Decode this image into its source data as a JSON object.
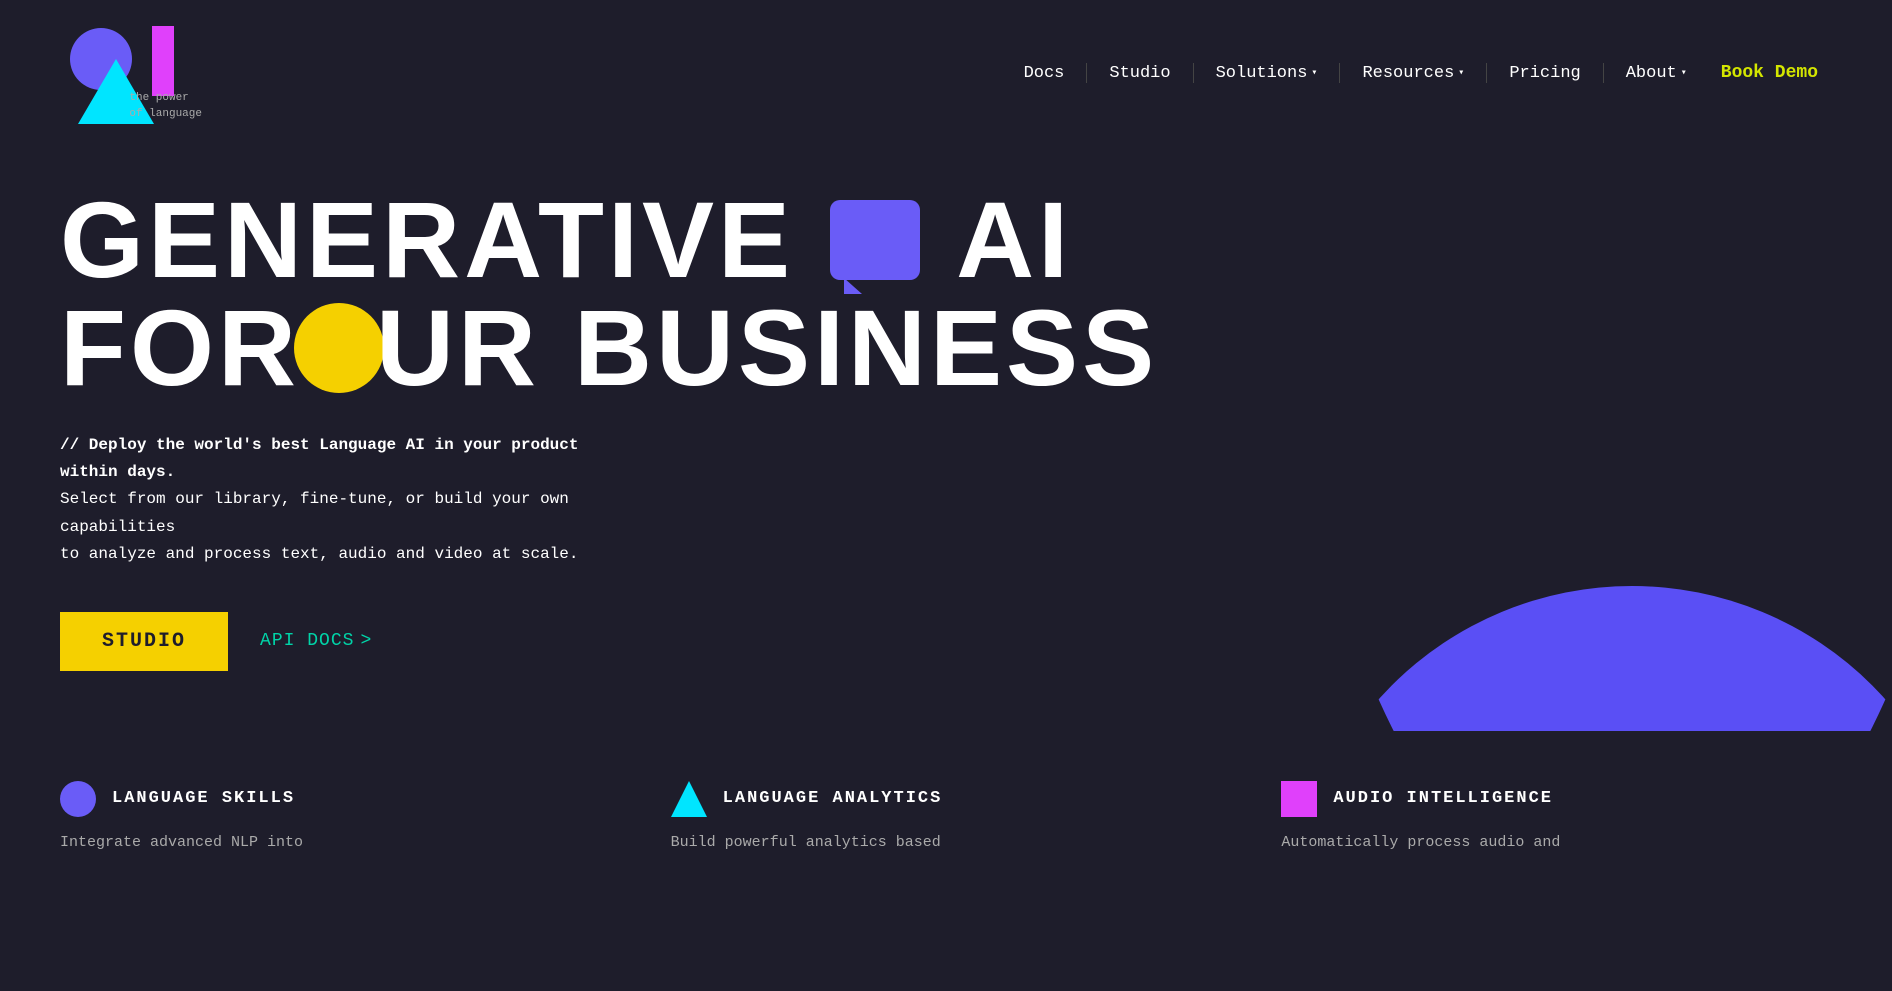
{
  "logo": {
    "tagline_line1": "the power",
    "tagline_line2": "of language"
  },
  "nav": {
    "docs_label": "Docs",
    "studio_label": "Studio",
    "solutions_label": "Solutions",
    "resources_label": "Resources",
    "pricing_label": "Pricing",
    "about_label": "About",
    "book_demo_label": "Book Demo"
  },
  "hero": {
    "headline_part1": "GENERATIVE",
    "headline_part2": "AI",
    "headline_line2_part1": "FOR ",
    "headline_line2_part2": "UR BUSINESS",
    "subtitle_line1": "// Deploy the world's best Language AI in your product within days.",
    "subtitle_line2": "Select from our library, fine-tune, or build your own capabilities",
    "subtitle_line3": "to analyze and process text, audio and video at scale.",
    "studio_btn": "STUDIO",
    "api_docs_btn": "API DOCS",
    "api_docs_arrow": ">"
  },
  "features": [
    {
      "id": "language-skills",
      "icon": "circle",
      "title": "LANGUAGE SKILLS",
      "description": "Integrate advanced NLP into"
    },
    {
      "id": "language-analytics",
      "icon": "triangle",
      "title": "LANGUAGE ANALYTICS",
      "description": "Build powerful analytics based"
    },
    {
      "id": "audio-intelligence",
      "icon": "square",
      "title": "AUDIO INTELLIGENCE",
      "description": "Automatically process audio and"
    }
  ]
}
